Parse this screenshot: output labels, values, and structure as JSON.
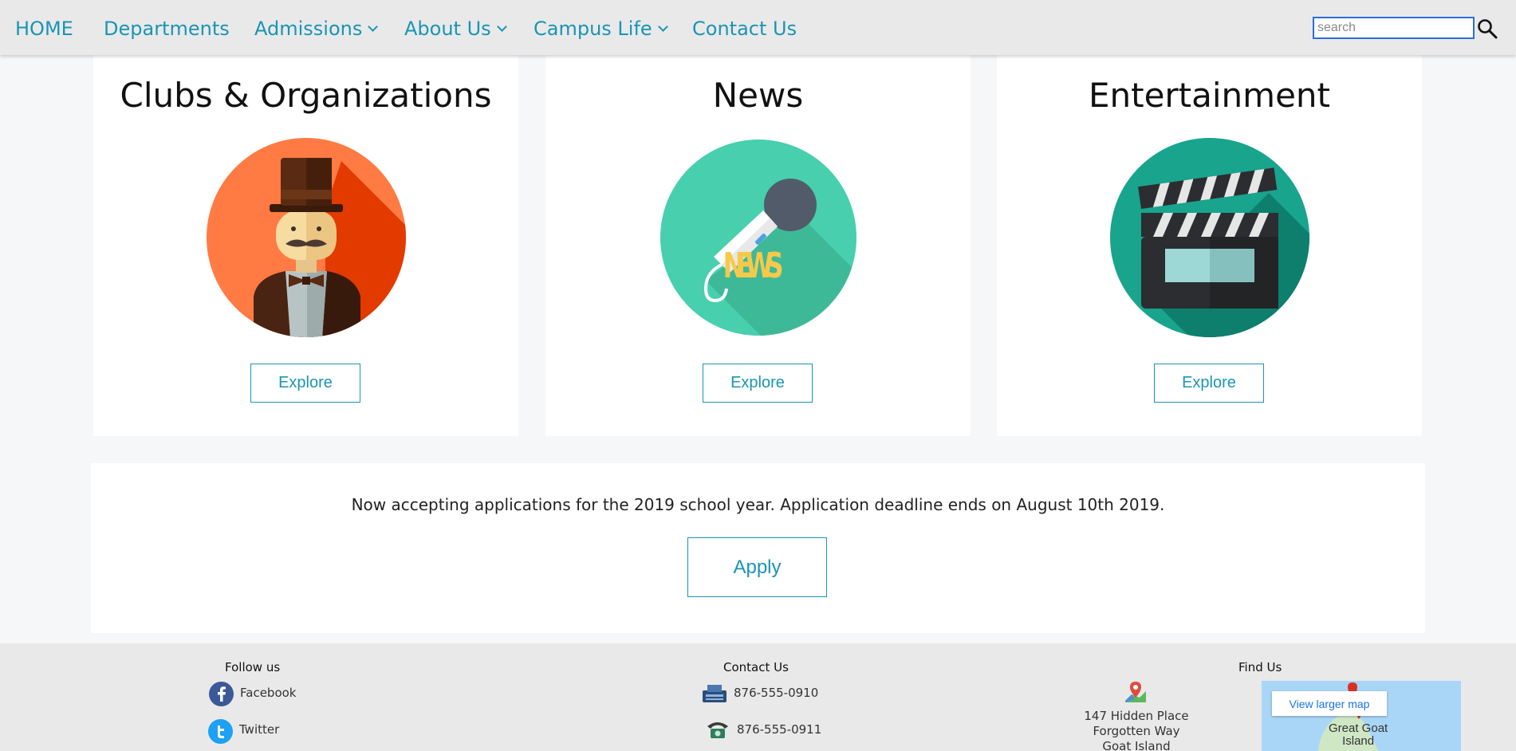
{
  "nav": {
    "home": "HOME",
    "departments": "Departments",
    "admissions": "Admissions",
    "about": "About Us",
    "campus_life": "Campus Life",
    "contact": "Contact Us",
    "search_placeholder": "search"
  },
  "cards": [
    {
      "title": "Clubs & Organizations",
      "button": "Explore",
      "icon": "gentleman-icon"
    },
    {
      "title": "News",
      "button": "Explore",
      "icon": "news-microphone-icon"
    },
    {
      "title": "Entertainment",
      "button": "Explore",
      "icon": "clapperboard-icon"
    }
  ],
  "apply": {
    "text": "Now accepting applications for the 2019 school year. Application deadline ends on August 10th 2019.",
    "button": "Apply"
  },
  "footer": {
    "follow_heading": "Follow us",
    "facebook": "Facebook",
    "twitter": "Twitter",
    "contact_heading": "Contact Us",
    "fax": "876-555-0910",
    "phone": "876-555-0911",
    "address_line1": "147 Hidden Place",
    "address_line2": "Forgotten Way",
    "address_line3": "Goat Island",
    "find_heading": "Find Us",
    "map_link": "View larger map",
    "map_label_1": "Great Goat",
    "map_label_2": "Island"
  },
  "colors": {
    "accent": "#1a95b3",
    "nav_bg": "#e9e9ea",
    "page_bg": "#f6f7f9"
  }
}
